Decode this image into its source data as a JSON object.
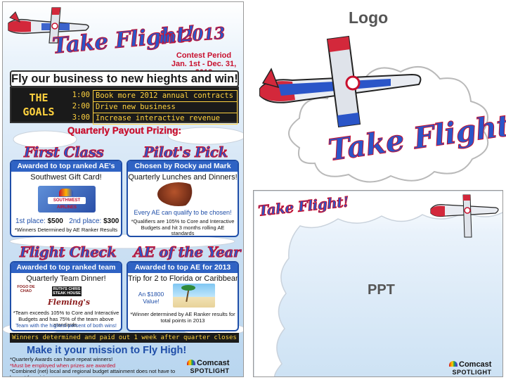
{
  "poster": {
    "title": "Take Flight!",
    "year": "in 2013",
    "contest_period": "Contest Period",
    "contest_dates": "Jan. 1st - Dec. 31, 2013",
    "tagline": "Fly our business to new hieghts and win!",
    "goals_label": "THE GOALS",
    "goals": [
      {
        "time": "1:00",
        "text": "Book more 2012 annual contracts"
      },
      {
        "time": "2:00",
        "text": "Drive new business"
      },
      {
        "time": "3:00",
        "text": "Increase interactive revenue"
      }
    ],
    "payout_title": "Quarterly Payout Prizing:",
    "first_class": {
      "title": "First Class",
      "band": "Awarded to top ranked AE's",
      "headline": "Southwest Gift Card!",
      "card_text": "SOUTHWEST AIRLINES",
      "prize_1_label": "1st place:",
      "prize_1_value": "$500",
      "prize_2_label": "2nd place:",
      "prize_2_value": "$300",
      "note": "*Winners Determined by AE Ranker Results"
    },
    "pilots_pick": {
      "title": "Pilot's Pick",
      "band": "Chosen by Rocky and Mark",
      "headline": "Quarterly Lunches and Dinners!",
      "highlight": "Every AE can qualify to be chosen!",
      "note": "*Qualifiers are 105% to Core and Interactive Budgets and hit 3 months rolling AE standards"
    },
    "flight_check": {
      "title": "Flight Check",
      "band": "Awarded to top ranked team",
      "headline": "Quarterly Team Dinner!",
      "logo_1": "FOGO DE CHAO",
      "logo_2": "RUTH'S CHRIS STEAK HOUSE",
      "logo_3": "Fleming's",
      "note": "*Team exceeds 105% to Core and Interactive Budgets and has 75% of the team above standards.",
      "highlight": "Team with the highest percent of both wins!"
    },
    "ae_of_year": {
      "title": "AE of the Year",
      "band": "Awarded to top AE for 2013",
      "headline": "Trip for 2 to Florida or Caribbean!",
      "value_text": "An $1800 Value!",
      "note": "*Winner determined by AE Ranker results for total points in 2013"
    },
    "winners_bar": "Winners determined and paid out 1 week after quarter closes",
    "mission": "Make it your mission to Fly High!",
    "footnotes": [
      "*Quarterly Awards can have repeat winners!",
      "*Must be employed when prizes are awarded",
      "*Combined (net) local and regional budget attainment does not have to be met for prizing"
    ],
    "brand_1": "Comcast",
    "brand_2": "SPOTLIGHT"
  },
  "logo_section": {
    "label": "Logo",
    "script": "Take Flight!"
  },
  "ppt_section": {
    "label": "PPT",
    "script": "Take Flight!",
    "brand_1": "Comcast",
    "brand_2": "SPOTLIGHT"
  },
  "colors": {
    "brand_blue": "#2a55c8",
    "brand_red": "#c8102e",
    "goal_yellow": "#ffd23f",
    "sky": "#cfe2f4"
  }
}
